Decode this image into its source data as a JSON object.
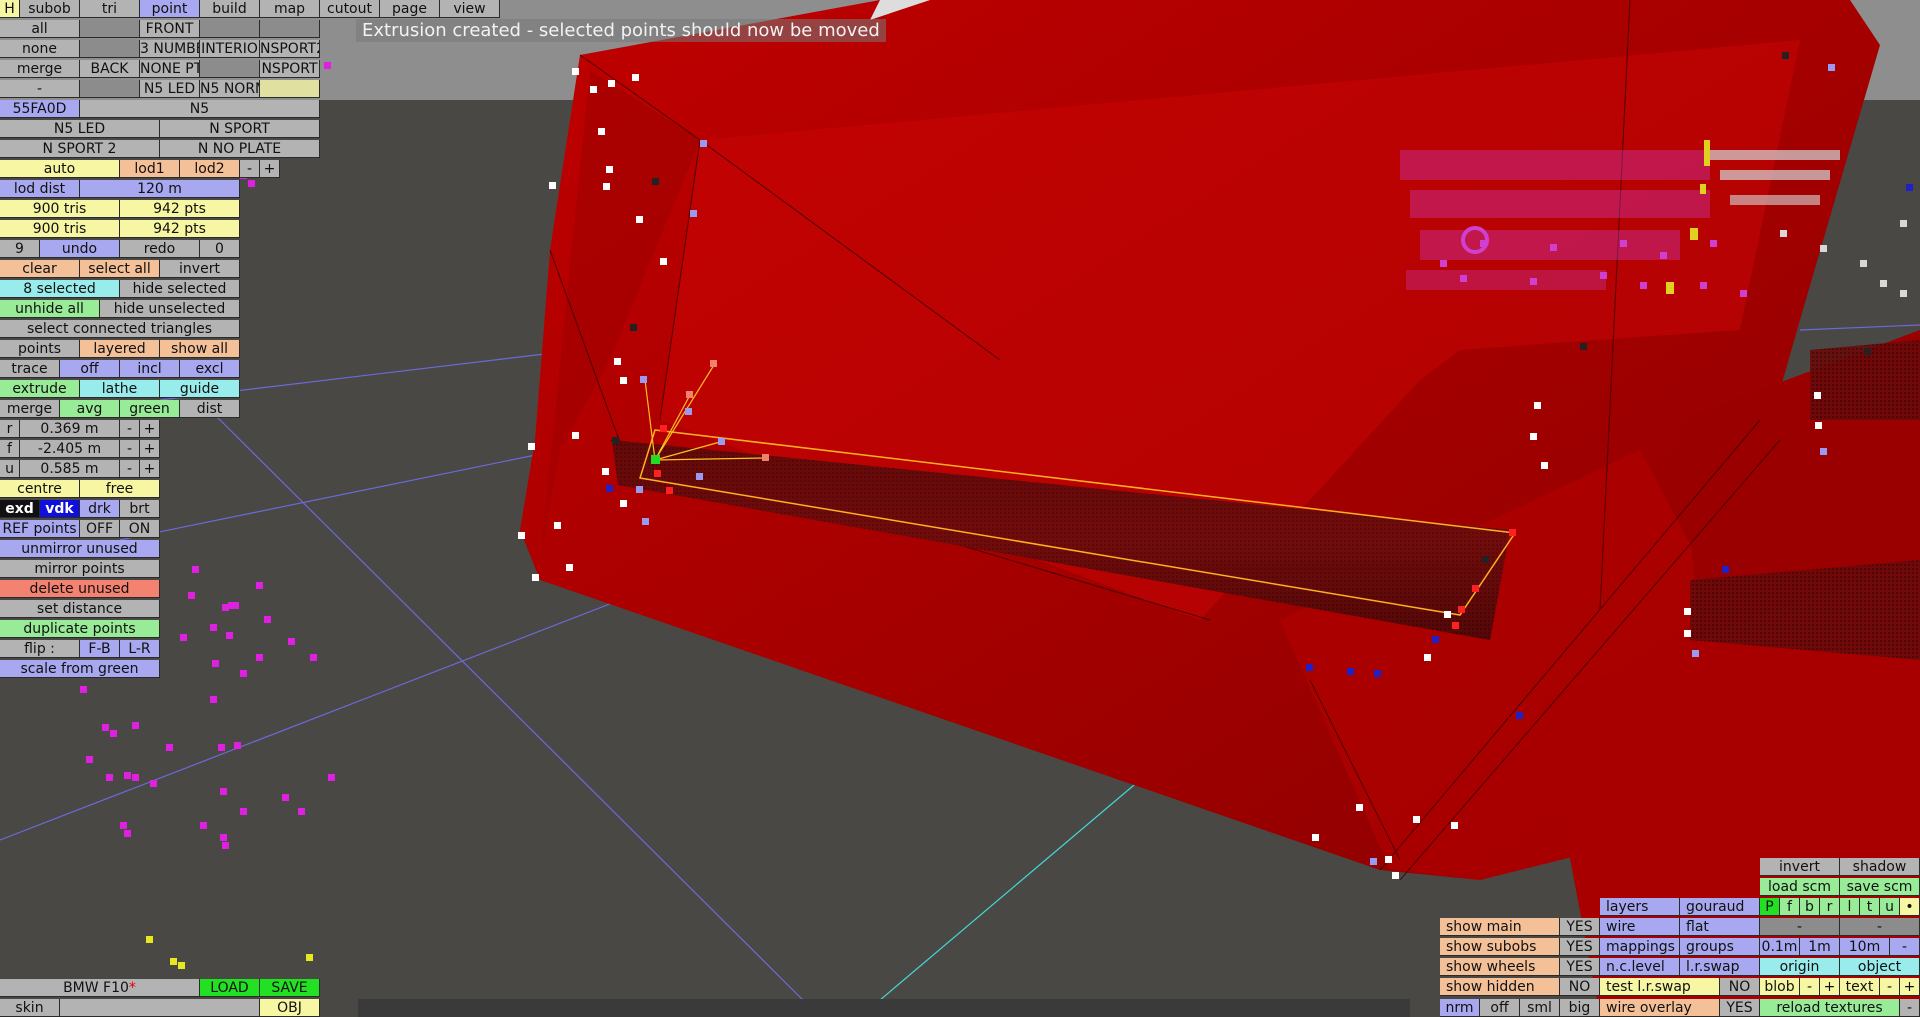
{
  "status_message": "Extrusion created - selected points should now be moved",
  "menu": {
    "h": "H",
    "subob": "subob",
    "tri": "tri",
    "point": "point",
    "build": "build",
    "map": "map",
    "cutout": "cutout",
    "page": "page",
    "view": "view"
  },
  "subob_panel": {
    "all": "all",
    "none": "none",
    "merge": "merge",
    "dash": "-",
    "front": "FRONT",
    "back": "BACK",
    "number": "3 NUMBE",
    "none_pt": "NONE PT",
    "n5led": "N5 LED",
    "interior": "INTERIO",
    "n5norm": "N5 NORM",
    "nsport2": "NSPORT2",
    "nsport": "NSPORT",
    "color_code": "55FA0D",
    "selected_name": "N5",
    "sub_items": [
      "N5 LED",
      "N SPORT",
      "N SPORT 2",
      "N NO PLATE"
    ]
  },
  "lod": {
    "auto": "auto",
    "lod1": "lod1",
    "lod2": "lod2",
    "minus": "-",
    "plus": "+",
    "dist_label": "lod dist",
    "dist_value": "120 m"
  },
  "stats": {
    "tris1": "900 tris",
    "pts1": "942 pts",
    "tris2": "900 tris",
    "pts2": "942 pts"
  },
  "undo_row": {
    "undo_count": "9",
    "undo": "undo",
    "redo": "redo",
    "redo_count": "0"
  },
  "selection": {
    "clear": "clear",
    "select_all": "select all",
    "invert": "invert",
    "selected_count": "8 selected",
    "hide_selected": "hide selected",
    "unhide_all": "unhide all",
    "hide_unselected": "hide unselected",
    "select_connected": "select connected triangles"
  },
  "points_row": {
    "points": "points",
    "layered": "layered",
    "show_all": "show all"
  },
  "trace_row": {
    "trace": "trace",
    "off": "off",
    "incl": "incl",
    "excl": "excl"
  },
  "ops_row": {
    "extrude": "extrude",
    "lathe": "lathe",
    "guide": "guide"
  },
  "merge_row": {
    "merge": "merge",
    "avg": "avg",
    "green": "green",
    "dist": "dist"
  },
  "coords": [
    {
      "axis": "r",
      "value": "0.369 m"
    },
    {
      "axis": "f",
      "value": "-2.405 m"
    },
    {
      "axis": "u",
      "value": "0.585 m"
    }
  ],
  "step_minus": "-",
  "step_plus": "+",
  "pivot": {
    "centre": "centre",
    "free": "free"
  },
  "theme": {
    "exd": "exd",
    "vdk": "vdk",
    "drk": "drk",
    "brt": "brt"
  },
  "ref_points": {
    "label": "REF points",
    "off": "OFF",
    "on": "ON"
  },
  "actions": {
    "unmirror": "unmirror unused",
    "mirror": "mirror points",
    "delete": "delete unused",
    "set_distance": "set distance",
    "duplicate": "duplicate points",
    "flip": "flip :",
    "fb": "F-B",
    "lr": "L-R",
    "scale": "scale from green"
  },
  "file": {
    "name": "BMW F10",
    "modified_mark": "*",
    "load": "LOAD",
    "save": "SAVE",
    "skin": "skin",
    "obj": "OBJ"
  },
  "display": {
    "rows": [
      {
        "label": "show main",
        "value": "YES"
      },
      {
        "label": "show subobs",
        "value": "YES"
      },
      {
        "label": "show wheels",
        "value": "YES"
      },
      {
        "label": "show hidden",
        "value": "NO"
      }
    ],
    "nrm": "nrm",
    "off": "off",
    "sml": "sml",
    "big": "big",
    "layers": "layers",
    "gouraud": "gouraud",
    "wire": "wire",
    "flat": "flat",
    "mappings": "mappings",
    "groups": "groups",
    "nclevel": "n.c.level",
    "lrswap": "l.r.swap",
    "test_lrswap": "test l.r.swap",
    "test_lrswap_value": "NO",
    "wire_overlay": "wire overlay",
    "wire_overlay_value": "YES"
  },
  "right_panel": {
    "invert": "invert",
    "shadow": "shadow",
    "load_scm": "load scm",
    "save_scm": "save scm",
    "letters": [
      "P",
      "f",
      "b",
      "r",
      "l",
      "t",
      "u"
    ],
    "dot": "•",
    "dash": "-",
    "d01": "0.1m",
    "d1": "1m",
    "d10": "10m",
    "origin": "origin",
    "object": "object",
    "blob": "blob",
    "text": "text",
    "minus": "-",
    "plus": "+",
    "reload": "reload textures"
  },
  "colors": {
    "car_red": "#a80000",
    "ground": "#4a4844",
    "sky": "#8a8a8a",
    "highlight_yellow": "#ffc020",
    "green_point": "#22dd22"
  }
}
